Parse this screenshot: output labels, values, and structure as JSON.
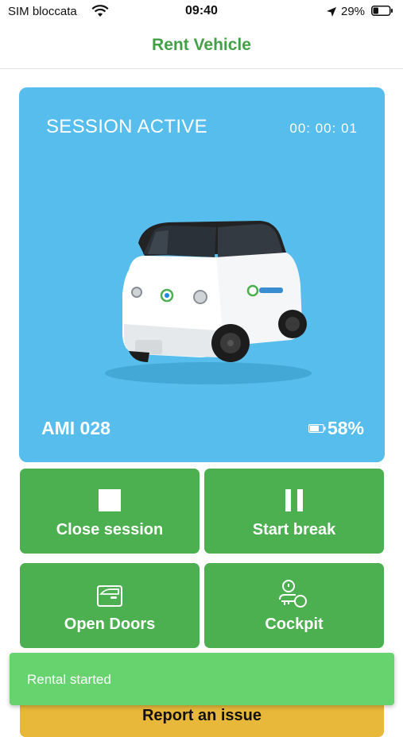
{
  "status_bar": {
    "carrier": "SIM bloccata",
    "time": "09:40",
    "battery_percent": "29%"
  },
  "nav": {
    "title": "Rent Vehicle"
  },
  "session": {
    "title": "SESSION ACTIVE",
    "timer": "00: 00: 01",
    "vehicle_name": "AMI 028",
    "battery_level": "58%",
    "card_color": "#56bdec"
  },
  "actions": [
    {
      "label": "Close session",
      "icon": "stop-square-icon"
    },
    {
      "label": "Start break",
      "icon": "pause-icon"
    },
    {
      "label": "Open Doors",
      "icon": "car-door-icon"
    },
    {
      "label": "Cockpit",
      "icon": "key-icon"
    }
  ],
  "bottom_button": {
    "label": "Report an issue"
  },
  "toast": {
    "message": "Rental started"
  },
  "colors": {
    "accent": "#43a047",
    "button": "#4caf50",
    "toast": "#66d36e"
  }
}
